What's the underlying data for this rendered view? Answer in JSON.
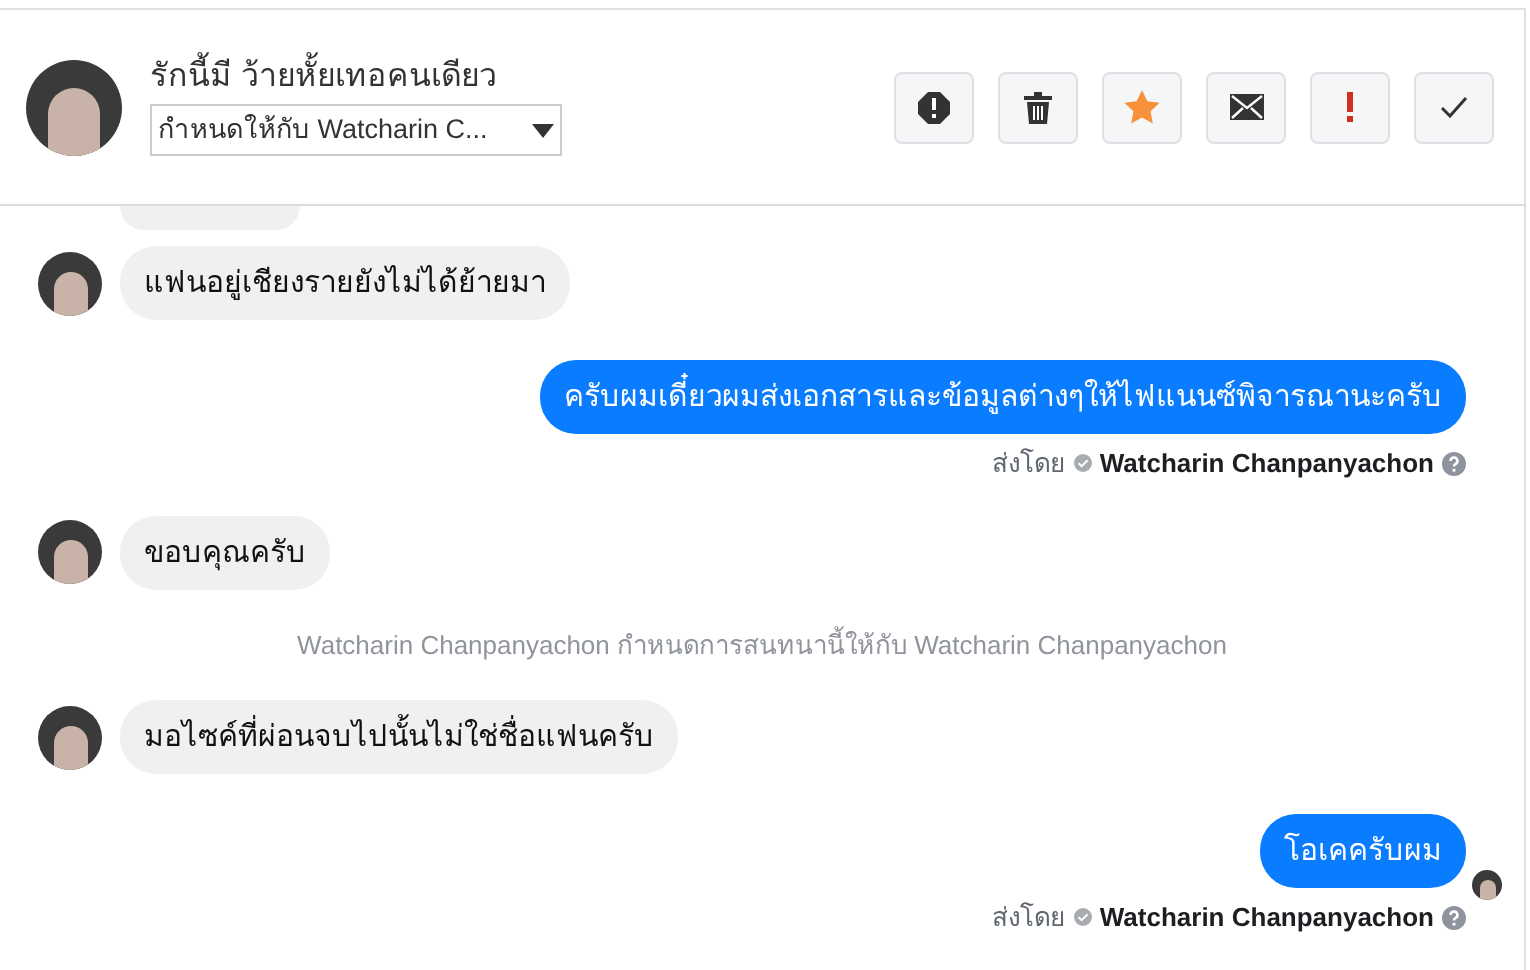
{
  "header": {
    "title": "รักนี้มี ว้ายหั้ยเทอคนเดียว",
    "assign_dropdown": "กำหนดให้กับ Watcharin C...",
    "actions": [
      {
        "kind": "spam"
      },
      {
        "kind": "delete"
      },
      {
        "kind": "star"
      },
      {
        "kind": "mail"
      },
      {
        "kind": "important"
      },
      {
        "kind": "done"
      }
    ]
  },
  "messages": [
    {
      "kind": "cut"
    },
    {
      "kind": "incoming",
      "text": "แฟนอยู่เชียงรายยังไม่ได้ย้ายมา"
    },
    {
      "kind": "outgoing",
      "text": "ครับผมเดี๋ยวผมส่งเอกสารและข้อมูลต่างๆให้ไฟแนนซ์พิจารณานะครับ",
      "sent_by_label": "ส่งโดย",
      "sender": "Watcharin Chanpanyachon",
      "seen": false
    },
    {
      "kind": "incoming",
      "text": "ขอบคุณครับ"
    },
    {
      "kind": "system",
      "text": "Watcharin Chanpanyachon กำหนดการสนทนานี้ให้กับ Watcharin Chanpanyachon"
    },
    {
      "kind": "incoming",
      "text": "มอไซค์ที่ผ่อนจบไปนั้นไม่ใช่ชื่อแฟนครับ"
    },
    {
      "kind": "outgoing",
      "text": "โอเคครับผม",
      "sent_by_label": "ส่งโดย",
      "sender": "Watcharin Chanpanyachon",
      "seen": true
    }
  ]
}
